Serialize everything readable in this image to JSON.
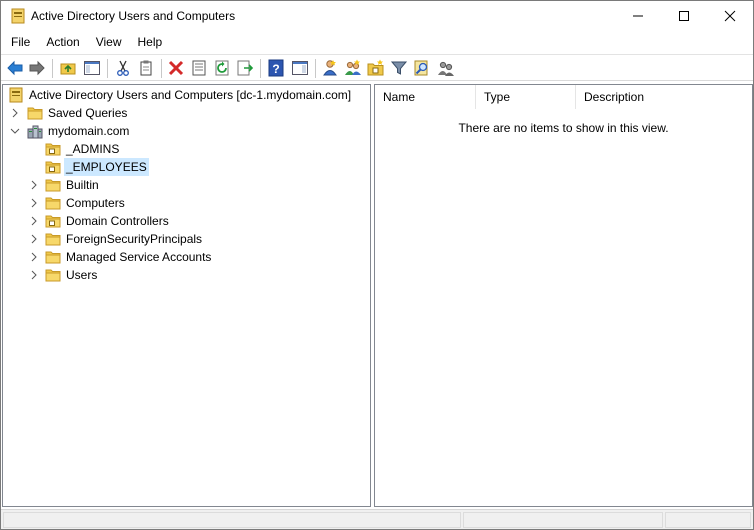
{
  "window": {
    "title": "Active Directory Users and Computers",
    "controls": [
      "minimize",
      "maximize",
      "close"
    ]
  },
  "menu": {
    "items": [
      "File",
      "Action",
      "View",
      "Help"
    ]
  },
  "toolbar": {
    "icons": [
      "back-arrow-icon",
      "forward-arrow-icon",
      "up-folder-icon",
      "show-hide-console-tree-icon",
      "cut-icon",
      "copy-icon",
      "delete-icon",
      "properties-icon",
      "refresh-icon",
      "export-list-icon",
      "help-icon",
      "show-hide-action-pane-icon",
      "new-user-icon",
      "new-group-icon",
      "new-ou-icon",
      "filter-icon",
      "find-icon",
      "add-to-group-icon"
    ]
  },
  "tree": {
    "root": "Active Directory Users and Computers [dc-1.mydomain.com]",
    "saved_queries": "Saved Queries",
    "domain": "mydomain.com",
    "children": [
      {
        "label": "_ADMINS",
        "type": "ou",
        "selected": false,
        "expandable": false
      },
      {
        "label": "_EMPLOYEES",
        "type": "ou",
        "selected": true,
        "expandable": false
      },
      {
        "label": "Builtin",
        "type": "folder",
        "selected": false,
        "expandable": true
      },
      {
        "label": "Computers",
        "type": "folder",
        "selected": false,
        "expandable": true
      },
      {
        "label": "Domain Controllers",
        "type": "ou",
        "selected": false,
        "expandable": true
      },
      {
        "label": "ForeignSecurityPrincipals",
        "type": "folder",
        "selected": false,
        "expandable": true
      },
      {
        "label": "Managed Service Accounts",
        "type": "folder",
        "selected": false,
        "expandable": true
      },
      {
        "label": "Users",
        "type": "folder",
        "selected": false,
        "expandable": true
      }
    ]
  },
  "list": {
    "columns": [
      "Name",
      "Type",
      "Description"
    ],
    "empty_message": "There are no items to show in this view."
  },
  "colors": {
    "selection": "#cce8ff",
    "folder": "#f0c94a",
    "folder_dark": "#d9a520"
  }
}
